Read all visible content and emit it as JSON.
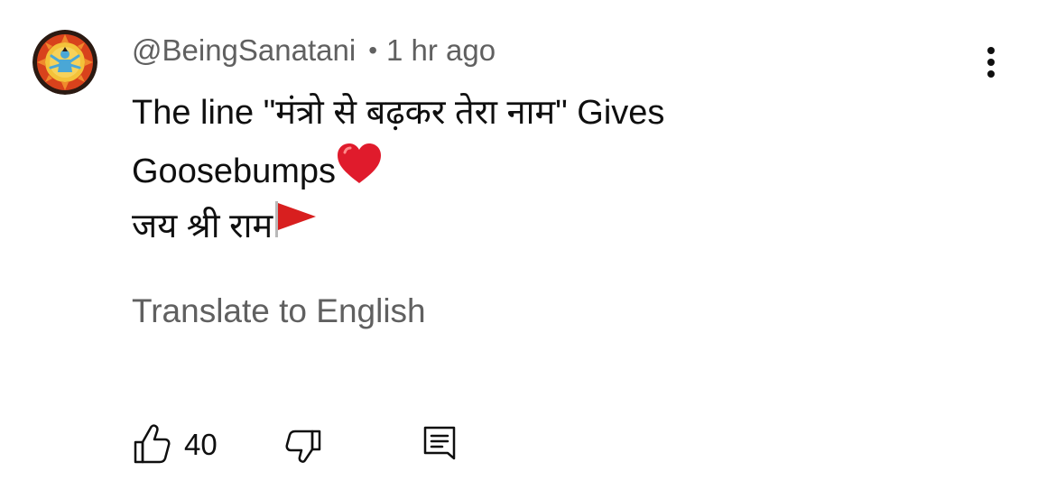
{
  "comment": {
    "author": "@BeingSanatani",
    "separator": "•",
    "time": "1 hr ago",
    "lines": [
      "The line \"मंत्रो से बढ़कर तेरा नाम\" Gives",
      "Goosebumps",
      "जय श्री राम"
    ],
    "emojis": {
      "heart": "red-heart",
      "flag": "saffron-flag"
    },
    "translate_label": "Translate to English",
    "like_count": "40"
  },
  "icons": {
    "menu": "kebab-menu-icon",
    "like": "thumbs-up-icon",
    "dislike": "thumbs-down-icon",
    "reply": "reply-comment-icon"
  },
  "colors": {
    "text_primary": "#0f0f0f",
    "text_secondary": "#606060",
    "heart": "#e01b2c",
    "flag": "#d81f1f"
  }
}
